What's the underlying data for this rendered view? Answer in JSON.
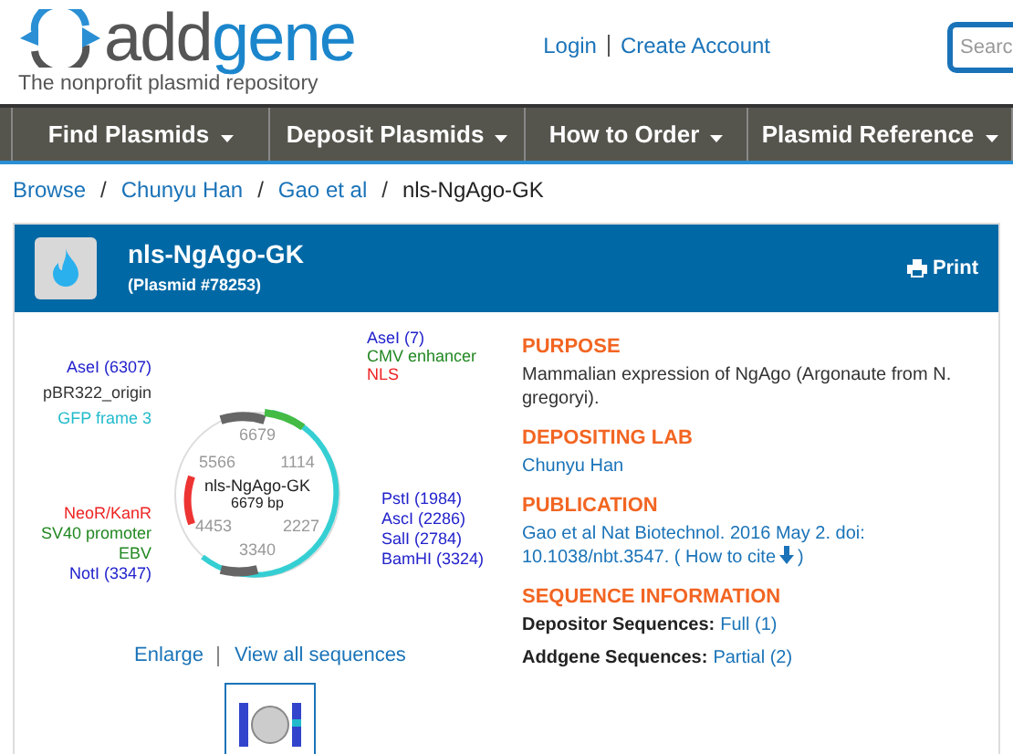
{
  "header": {
    "logo_word_left": "add",
    "logo_word_right": "gene",
    "tagline": "The nonprofit plasmid repository",
    "links": [
      "Login",
      "Create Account"
    ],
    "search": {
      "placeholder": "Searc"
    }
  },
  "nav": [
    {
      "label": "Find Plasmids"
    },
    {
      "label": "Deposit Plasmids"
    },
    {
      "label": "How to Order"
    },
    {
      "label": "Plasmid Reference"
    }
  ],
  "breadcrumb": [
    {
      "kind": "link",
      "label": "Browse"
    },
    {
      "kind": "separator",
      "label": "/"
    },
    {
      "kind": "link",
      "label": "Chunyu Han"
    },
    {
      "kind": "separator",
      "label": "/"
    },
    {
      "kind": "link",
      "label": "Gao et al"
    },
    {
      "kind": "separator",
      "label": "/"
    },
    {
      "kind": "current",
      "label": "nls-NgAgo-GK"
    }
  ],
  "plasmid": {
    "name": "nls-NgAgo-GK",
    "id": "(Plasmid #78253)",
    "print": "Print"
  },
  "map": {
    "center_name": "nls-NgAgo-GK",
    "size": "6679 bp",
    "ticks": [
      "6679",
      "1114",
      "2227",
      "3340",
      "4453",
      "5566"
    ],
    "right_labels": [
      {
        "text": "AseI (7)",
        "color": "#2222cc"
      },
      {
        "text": "CMV enhancer",
        "color": "#228822"
      },
      {
        "text": "NLS",
        "color": "#ee2222"
      },
      {
        "text": "PstI (1984)",
        "color": "#2222cc"
      },
      {
        "text": "AscI (2286)",
        "color": "#2222cc"
      },
      {
        "text": "SalI (2784)",
        "color": "#2222cc"
      },
      {
        "text": "BamHI (3324)",
        "color": "#2222cc"
      }
    ],
    "left_labels": [
      {
        "text": "AseI (6307)",
        "color": "#2222cc"
      },
      {
        "text": "pBR322_origin",
        "color": "#333333"
      },
      {
        "text": "GFP frame 3",
        "color": "#22bbcc"
      },
      {
        "text": "NeoR/KanR",
        "color": "#ee2222"
      },
      {
        "text": "SV40 promoter",
        "color": "#228822"
      },
      {
        "text": "EBV",
        "color": "#228822"
      },
      {
        "text": "NotI (3347)",
        "color": "#2222cc"
      }
    ],
    "links": [
      "Enlarge",
      "View all sequences"
    ]
  },
  "details": [
    {
      "kind": "text",
      "heading": "PURPOSE",
      "text": "Mammalian expression of NgAgo (Argonaute from N. gregoryi)."
    },
    {
      "kind": "link",
      "heading": "DEPOSITING LAB",
      "text": "Chunyu Han"
    },
    {
      "kind": "publication",
      "heading": "PUBLICATION",
      "text": "Gao et al Nat Biotechnol. 2016 May 2. doi: 10.1038/nbt.3547.",
      "cite_open": "(",
      "cite": "How to cite",
      "cite_close": ")"
    },
    {
      "kind": "sequences",
      "heading": "SEQUENCE INFORMATION",
      "rows": [
        {
          "label": "Depositor Sequences:",
          "link": "Full (1)"
        },
        {
          "label": "Addgene Sequences:",
          "link": "Partial (2)"
        }
      ]
    }
  ]
}
